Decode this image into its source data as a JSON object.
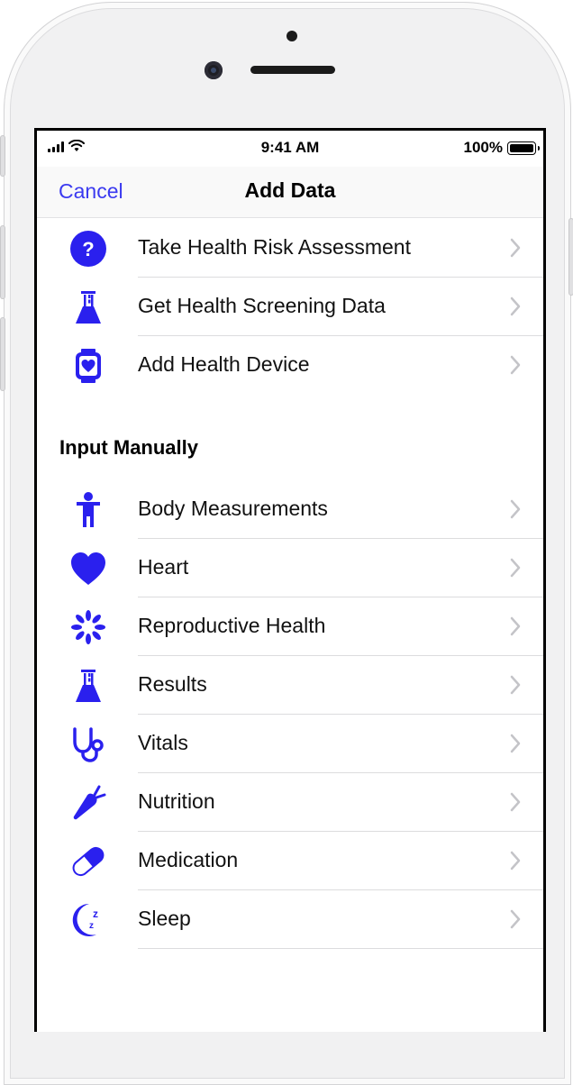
{
  "status_bar": {
    "time": "9:41 AM",
    "battery": "100%"
  },
  "nav": {
    "cancel_label": "Cancel",
    "title": "Add Data"
  },
  "top_items": [
    {
      "label": "Take Health Risk Assessment",
      "icon": "question-circle-icon"
    },
    {
      "label": "Get Health Screening Data",
      "icon": "lab-flask-icon"
    },
    {
      "label": "Add Health Device",
      "icon": "watch-heart-icon"
    }
  ],
  "section": {
    "title": "Input Manually"
  },
  "manual_items": [
    {
      "label": "Body Measurements",
      "icon": "person-icon"
    },
    {
      "label": "Heart",
      "icon": "heart-icon"
    },
    {
      "label": "Reproductive Health",
      "icon": "flower-icon"
    },
    {
      "label": "Results",
      "icon": "lab-flask-icon"
    },
    {
      "label": "Vitals",
      "icon": "stethoscope-icon"
    },
    {
      "label": "Nutrition",
      "icon": "carrot-icon"
    },
    {
      "label": "Medication",
      "icon": "pill-icon"
    },
    {
      "label": "Sleep",
      "icon": "moon-zzz-icon"
    }
  ],
  "colors": {
    "accent": "#3b3af0",
    "icon": "#2a20ee"
  }
}
